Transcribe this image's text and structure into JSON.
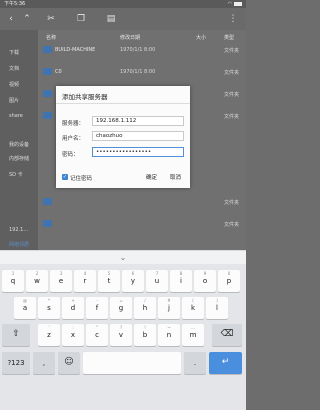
{
  "status": {
    "time": "下午5:36"
  },
  "toolbar": {
    "buttons": [
      "back-icon",
      "up-icon",
      "cut-icon",
      "copy-icon",
      "paste-icon",
      "more-icon"
    ]
  },
  "sidebar": {
    "items": [
      {
        "label": "下载"
      },
      {
        "label": "文档"
      },
      {
        "label": "视频"
      },
      {
        "label": "图片"
      },
      {
        "label": "share"
      },
      {
        "label": "我的设备"
      },
      {
        "label": "内部存储"
      },
      {
        "label": "SD 卡"
      },
      {
        "label": "192.1..."
      },
      {
        "label": "网络邻居"
      }
    ]
  },
  "list": {
    "headers": {
      "name": "名称",
      "date": "修改日期",
      "size": "大小",
      "type": "类型"
    },
    "rows": [
      {
        "name": "BUILD-MACHINE",
        "date": "1970/1/1 8:00",
        "type": "文件夹"
      },
      {
        "name": "C0",
        "date": "1970/1/1 8:00",
        "type": "文件夹"
      },
      {
        "name": "",
        "date": "",
        "type": "文件夹"
      },
      {
        "name": "",
        "date": "",
        "type": "文件夹"
      },
      {
        "name": "",
        "date": "",
        "type": "文件夹"
      },
      {
        "name": "",
        "date": "",
        "type": "文件夹"
      }
    ]
  },
  "dialog": {
    "title": "添加共享服务器",
    "server_label": "服务器：",
    "server_value": "192.168.1.112",
    "user_label": "用户名：",
    "user_value": "chaozhuo",
    "password_label": "密码：",
    "password_value": "•••••••••••••••••",
    "remember_label": "记住密码",
    "ok_label": "确定",
    "cancel_label": "取消"
  },
  "keyboard": {
    "row1": [
      {
        "k": "q",
        "s": "1"
      },
      {
        "k": "w",
        "s": "2"
      },
      {
        "k": "e",
        "s": "3"
      },
      {
        "k": "r",
        "s": "4"
      },
      {
        "k": "t",
        "s": "5"
      },
      {
        "k": "y",
        "s": "6"
      },
      {
        "k": "u",
        "s": "7"
      },
      {
        "k": "i",
        "s": "8"
      },
      {
        "k": "o",
        "s": "9"
      },
      {
        "k": "p",
        "s": "0"
      }
    ],
    "row2": [
      {
        "k": "a",
        "s": "@"
      },
      {
        "k": "s",
        "s": "*"
      },
      {
        "k": "d",
        "s": "+"
      },
      {
        "k": "f",
        "s": "-"
      },
      {
        "k": "g",
        "s": "="
      },
      {
        "k": "h",
        "s": "/"
      },
      {
        "k": "j",
        "s": "#"
      },
      {
        "k": "k",
        "s": "("
      },
      {
        "k": "l",
        "s": ")"
      }
    ],
    "row3": [
      {
        "k": "z",
        "s": "'"
      },
      {
        "k": "x",
        "s": ":"
      },
      {
        "k": "c",
        "s": "\""
      },
      {
        "k": "v",
        "s": "?"
      },
      {
        "k": "b",
        "s": "!"
      },
      {
        "k": "n",
        "s": "~"
      },
      {
        "k": "m",
        "s": "…"
      }
    ],
    "sym_label": "?123",
    "comma": ",",
    "period": ".",
    "icons": [
      "chevron-down-icon",
      "shift-icon",
      "backspace-icon",
      "emoji-icon",
      "enter-icon"
    ]
  },
  "colors": {
    "accent": "#4a8fdd",
    "folder": "#3f74b0",
    "dim_overlay": "#6d6d6d"
  }
}
